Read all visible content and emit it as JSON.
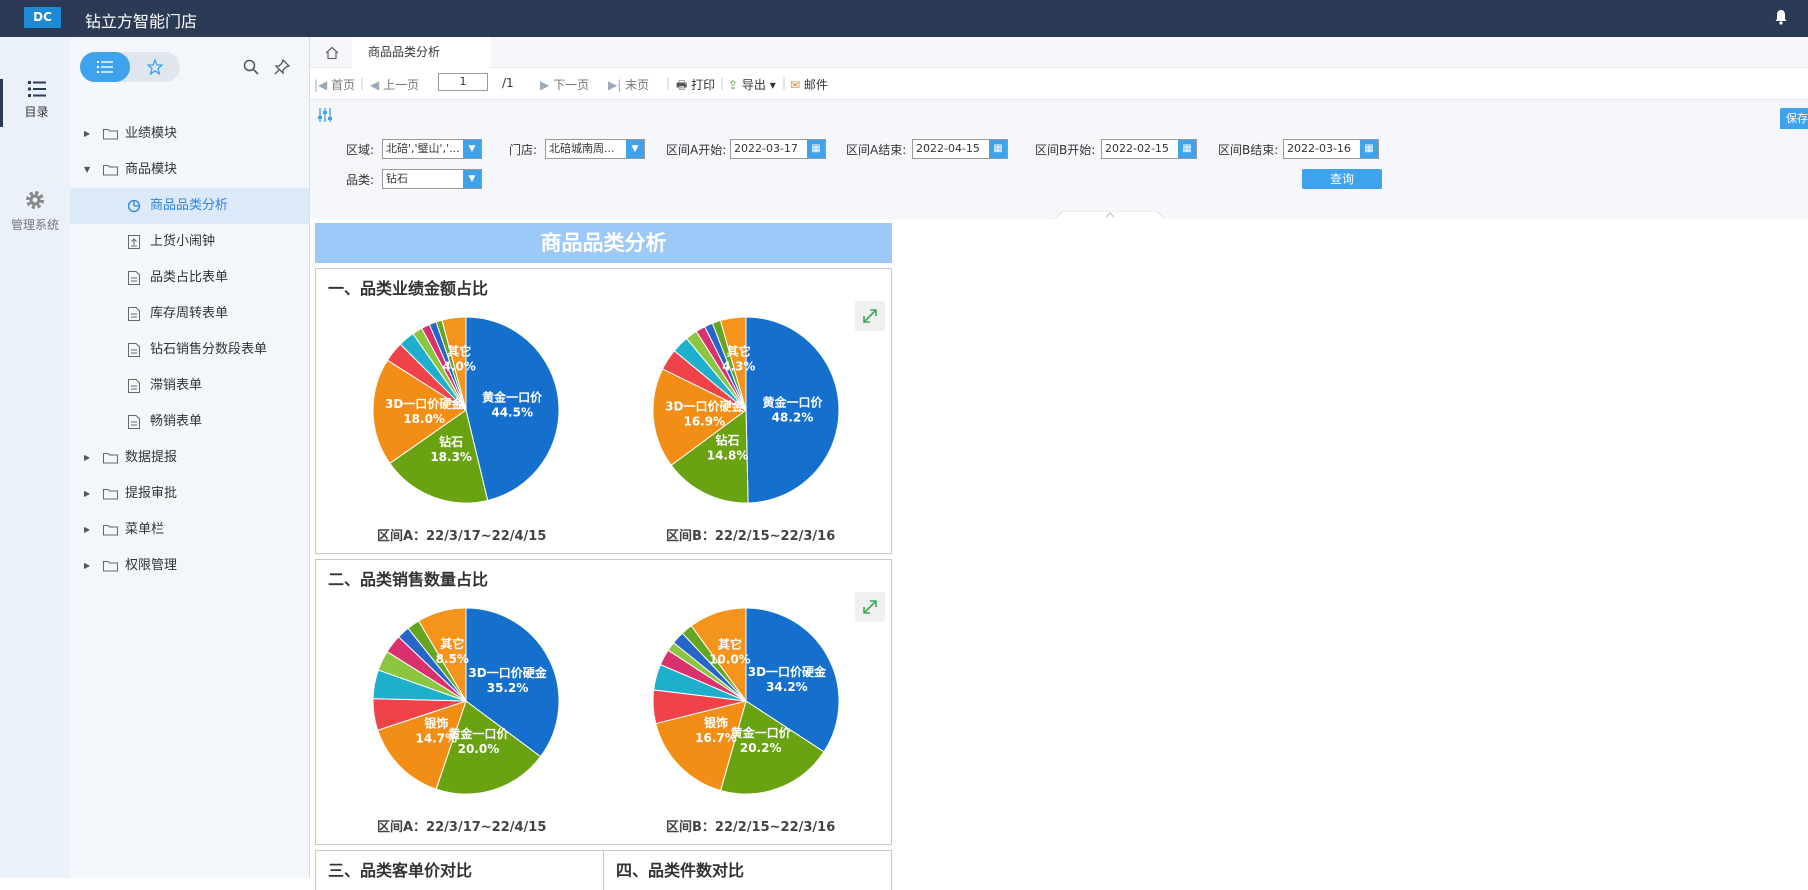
{
  "app": {
    "logo_text": "DC",
    "title": "钻立方智能门店"
  },
  "rail": {
    "items": [
      {
        "label": "目录"
      },
      {
        "label": "管理系统"
      }
    ]
  },
  "sidebar": {
    "tree": [
      {
        "label": "业绩模块"
      },
      {
        "label": "商品模块"
      },
      {
        "label": "商品品类分析"
      },
      {
        "label": "上货小闹钟"
      },
      {
        "label": "品类占比表单"
      },
      {
        "label": "库存周转表单"
      },
      {
        "label": "钻石销售分数段表单"
      },
      {
        "label": "滞销表单"
      },
      {
        "label": "畅销表单"
      },
      {
        "label": "数据提报"
      },
      {
        "label": "提报审批"
      },
      {
        "label": "菜单栏"
      },
      {
        "label": "权限管理"
      }
    ]
  },
  "tabs": {
    "active": "商品品类分析"
  },
  "toolbar": {
    "first": "首页",
    "prev": "上一页",
    "page": "1",
    "total": "/1",
    "next": "下一页",
    "last": "末页",
    "print": "打印",
    "export": "导出",
    "mail": "邮件",
    "save": "保存"
  },
  "filters": {
    "region_label": "区域:",
    "region_value": "北碚','璧山','...",
    "store_label": "门店:",
    "store_value": "北碚城南周...",
    "a_start_label": "区间A开始:",
    "a_start": "2022-03-17",
    "a_end_label": "区间A结束:",
    "a_end": "2022-04-15",
    "b_start_label": "区间B开始:",
    "b_start": "2022-02-15",
    "b_end_label": "区间B结束:",
    "b_end": "2022-03-16",
    "category_label": "品类:",
    "category_value": "钻石",
    "query": "查询"
  },
  "report": {
    "title": "商品品类分析",
    "s1_title": "一、品类业绩金额占比",
    "s2_title": "二、品类销售数量占比",
    "s3_title": "三、品类客单价对比",
    "s4_title": "四、品类件数对比",
    "range_a": "区间A：22/3/17~22/4/15",
    "range_b": "区间B：22/2/15~22/3/16"
  },
  "colors": {
    "topbar": "#2b3a55",
    "accent": "#3fa2ec",
    "active_bg": "#dbe9f8"
  },
  "chart_data": [
    {
      "type": "pie",
      "slices": [
        {
          "label": "黄金一口价",
          "value": 44.5,
          "color": "#1570cd",
          "show": true
        },
        {
          "label": "钻石",
          "value": 18.3,
          "color": "#6aa312",
          "show": true
        },
        {
          "label": "3D一口价硬金",
          "value": 18.0,
          "color": "#f28e15",
          "show": true
        },
        {
          "label": "",
          "value": 3.4,
          "color": "#f0424a",
          "show": false
        },
        {
          "label": "",
          "value": 2.7,
          "color": "#1eafcc",
          "show": false
        },
        {
          "label": "",
          "value": 1.7,
          "color": "#8bc640",
          "show": false
        },
        {
          "label": "",
          "value": 1.4,
          "color": "#d9316e",
          "show": false
        },
        {
          "label": "",
          "value": 1.2,
          "color": "#2566c8",
          "show": false
        },
        {
          "label": "",
          "value": 1.0,
          "color": "#64a522",
          "show": false
        },
        {
          "label": "其它",
          "value": 4.0,
          "color": "#f5941d",
          "show": true
        }
      ]
    },
    {
      "type": "pie",
      "slices": [
        {
          "label": "黄金一口价",
          "value": 48.2,
          "color": "#1570cd",
          "show": true
        },
        {
          "label": "钻石",
          "value": 14.8,
          "color": "#6aa312",
          "show": true
        },
        {
          "label": "3D一口价硬金",
          "value": 16.9,
          "color": "#f28e15",
          "show": true
        },
        {
          "label": "",
          "value": 3.6,
          "color": "#f0424a",
          "show": false
        },
        {
          "label": "",
          "value": 2.9,
          "color": "#1eafcc",
          "show": false
        },
        {
          "label": "",
          "value": 2.0,
          "color": "#8bc640",
          "show": false
        },
        {
          "label": "",
          "value": 1.6,
          "color": "#d9316e",
          "show": false
        },
        {
          "label": "",
          "value": 1.4,
          "color": "#2566c8",
          "show": false
        },
        {
          "label": "",
          "value": 1.4,
          "color": "#64a522",
          "show": false
        },
        {
          "label": "其它",
          "value": 4.3,
          "color": "#f5941d",
          "show": true
        }
      ]
    },
    {
      "type": "pie",
      "slices": [
        {
          "label": "3D一口价硬金",
          "value": 35.2,
          "color": "#1570cd",
          "show": true
        },
        {
          "label": "黄金一口价",
          "value": 20.0,
          "color": "#6aa312",
          "show": true
        },
        {
          "label": "银饰",
          "value": 14.7,
          "color": "#f28e15",
          "show": true
        },
        {
          "label": "",
          "value": 5.5,
          "color": "#f0424a",
          "show": false
        },
        {
          "label": "",
          "value": 5.0,
          "color": "#1eafcc",
          "show": false
        },
        {
          "label": "",
          "value": 3.5,
          "color": "#8bc640",
          "show": false
        },
        {
          "label": "",
          "value": 3.2,
          "color": "#d9316e",
          "show": false
        },
        {
          "label": "",
          "value": 2.2,
          "color": "#2566c8",
          "show": false
        },
        {
          "label": "",
          "value": 2.2,
          "color": "#64a522",
          "show": false
        },
        {
          "label": "其它",
          "value": 8.5,
          "color": "#f5941d",
          "show": true
        }
      ]
    },
    {
      "type": "pie",
      "slices": [
        {
          "label": "3D一口价硬金",
          "value": 34.2,
          "color": "#1570cd",
          "show": true
        },
        {
          "label": "黄金一口价",
          "value": 20.2,
          "color": "#6aa312",
          "show": true
        },
        {
          "label": "银饰",
          "value": 16.7,
          "color": "#f28e15",
          "show": true
        },
        {
          "label": "",
          "value": 5.8,
          "color": "#f0424a",
          "show": false
        },
        {
          "label": "",
          "value": 4.5,
          "color": "#1eafcc",
          "show": false
        },
        {
          "label": "",
          "value": 2.8,
          "color": "#d9316e",
          "show": false
        },
        {
          "label": "",
          "value": 1.6,
          "color": "#8bc640",
          "show": false
        },
        {
          "label": "",
          "value": 2.2,
          "color": "#2566c8",
          "show": false
        },
        {
          "label": "",
          "value": 2.0,
          "color": "#64a522",
          "show": false
        },
        {
          "label": "其它",
          "value": 10.0,
          "color": "#f5941d",
          "show": true
        }
      ]
    }
  ]
}
